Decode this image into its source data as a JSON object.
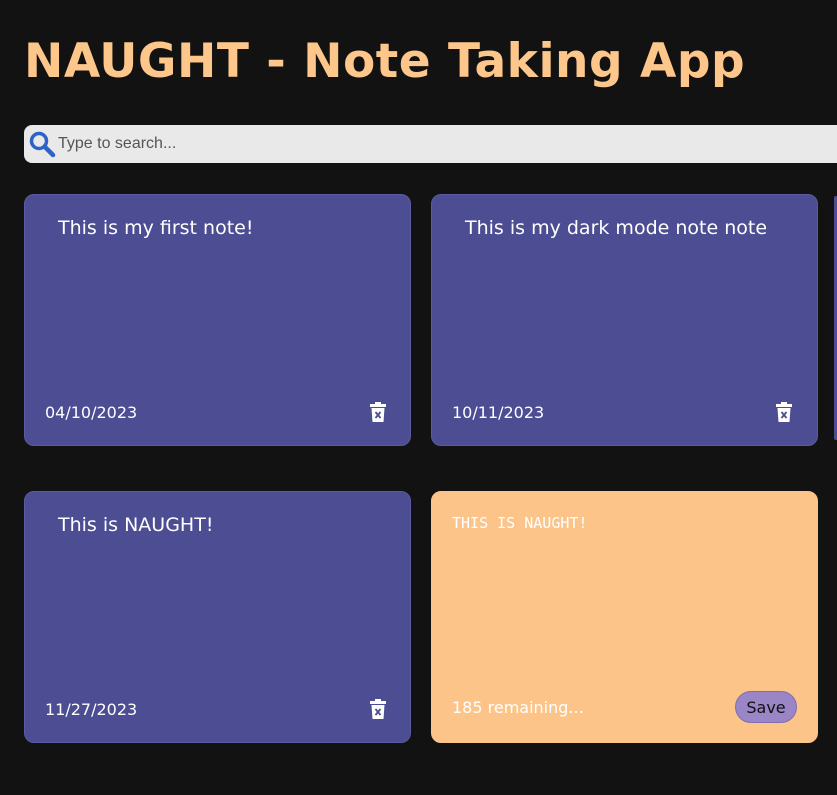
{
  "app": {
    "title": "NAUGHT - Note Taking App"
  },
  "search": {
    "placeholder": "Type to search...",
    "value": "",
    "icon": "search-icon"
  },
  "colors": {
    "background": "#121212",
    "title": "#fdc68a",
    "note": "#4c4d93",
    "new_note": "#fdc489",
    "save_button": "#9a85c6",
    "search_icon": "#2d62c9"
  },
  "notes": [
    {
      "text": "This is my first note!",
      "date": "04/10/2023",
      "delete_icon": "trash-icon"
    },
    {
      "text": "This is my dark mode note note",
      "date": "10/11/2023",
      "delete_icon": "trash-icon"
    },
    {
      "text": "This is NAUGHT!",
      "date": "11/27/2023",
      "delete_icon": "trash-icon"
    }
  ],
  "new_note": {
    "value": "THIS IS NAUGHT!",
    "remaining_label": "185 remaining...",
    "save_label": "Save"
  }
}
